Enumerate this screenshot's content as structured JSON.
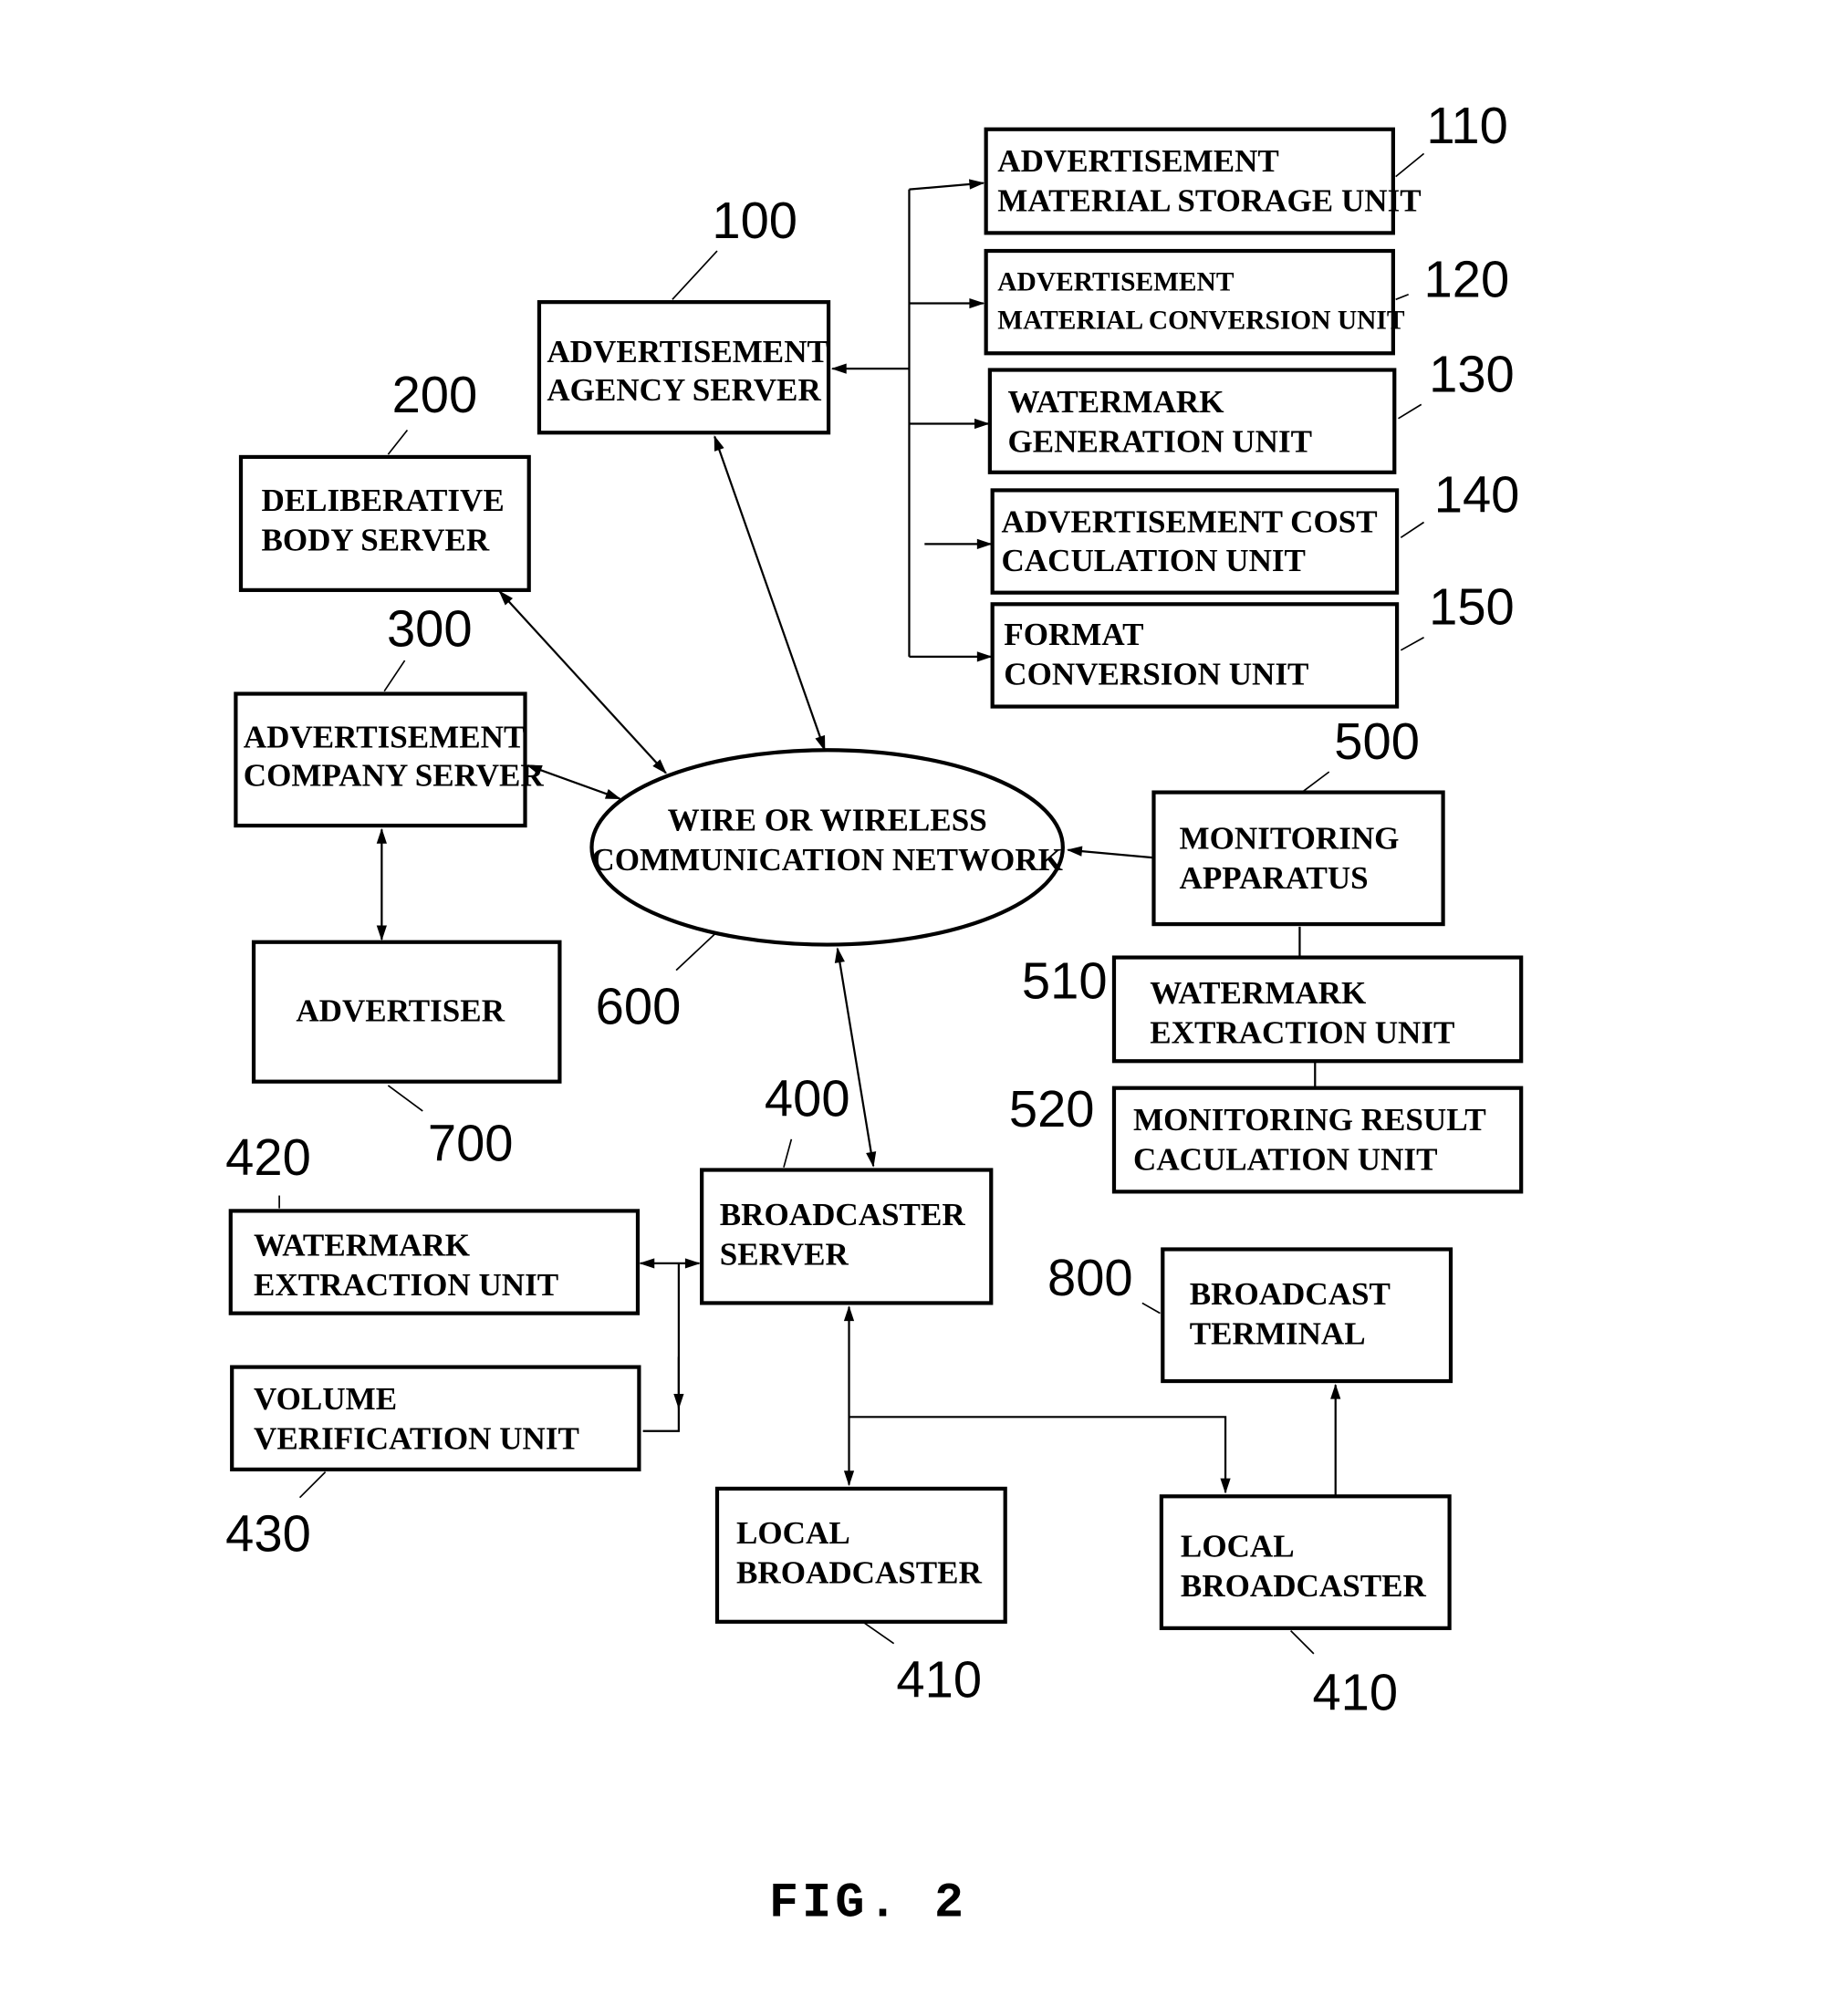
{
  "figure": {
    "caption": "FIG. 2",
    "nodes": {
      "n100": {
        "ref": "100",
        "lines": [
          "ADVERTISEMENT",
          "AGENCY SERVER"
        ]
      },
      "n110": {
        "ref": "110",
        "lines": [
          "ADVERTISEMENT",
          "MATERIAL STORAGE UNIT"
        ]
      },
      "n120": {
        "ref": "120",
        "lines": [
          "ADVERTISEMENT",
          "MATERIAL CONVERSION UNIT"
        ]
      },
      "n130": {
        "ref": "130",
        "lines": [
          "WATERMARK",
          "GENERATION UNIT"
        ]
      },
      "n140": {
        "ref": "140",
        "lines": [
          "ADVERTISEMENT COST",
          "CACULATION UNIT"
        ]
      },
      "n150": {
        "ref": "150",
        "lines": [
          "FORMAT",
          "CONVERSION UNIT"
        ]
      },
      "n200": {
        "ref": "200",
        "lines": [
          "DELIBERATIVE",
          "BODY SERVER"
        ]
      },
      "n300": {
        "ref": "300",
        "lines": [
          "ADVERTISEMENT",
          "COMPANY SERVER"
        ]
      },
      "n400": {
        "ref": "400",
        "lines": [
          "BROADCASTER",
          "SERVER"
        ]
      },
      "n410a": {
        "ref": "410",
        "lines": [
          "LOCAL",
          "BROADCASTER"
        ]
      },
      "n410b": {
        "ref": "410",
        "lines": [
          "LOCAL",
          "BROADCASTER"
        ]
      },
      "n420": {
        "ref": "420",
        "lines": [
          "WATERMARK",
          "EXTRACTION UNIT"
        ]
      },
      "n430": {
        "ref": "430",
        "lines": [
          "VOLUME",
          "VERIFICATION UNIT"
        ]
      },
      "n500": {
        "ref": "500",
        "lines": [
          "MONITORING",
          "APPARATUS"
        ]
      },
      "n510": {
        "ref": "510",
        "lines": [
          "WATERMARK",
          "EXTRACTION UNIT"
        ]
      },
      "n520": {
        "ref": "520",
        "lines": [
          "MONITORING RESULT",
          "CACULATION UNIT"
        ]
      },
      "n600": {
        "ref": "600",
        "lines": [
          "WIRE OR WIRELESS",
          "COMMUNICATION NETWORK"
        ]
      },
      "n700": {
        "ref": "700",
        "lines": [
          "ADVERTISER"
        ]
      },
      "n800": {
        "ref": "800",
        "lines": [
          "BROADCAST",
          "TERMINAL"
        ]
      }
    }
  }
}
